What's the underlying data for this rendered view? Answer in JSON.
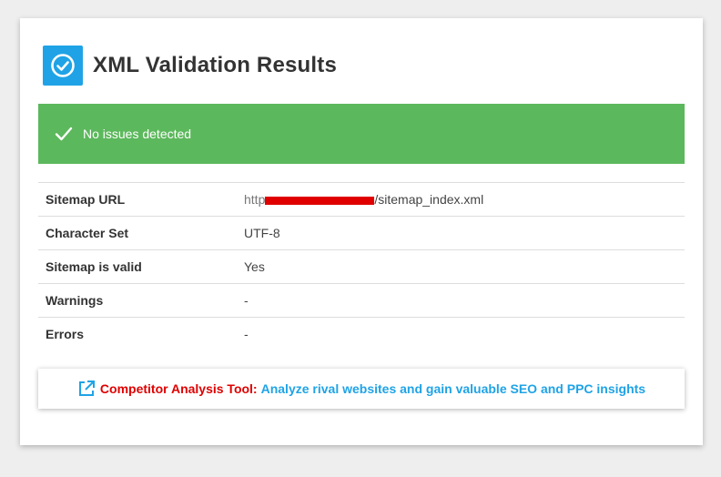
{
  "header": {
    "title": "XML Validation Results",
    "icon": "check-circle-icon",
    "icon_color": "#1fa3e6"
  },
  "banner": {
    "message": "No issues detected",
    "icon": "checkmark-icon",
    "color": "#5cb85c"
  },
  "results": [
    {
      "label": "Sitemap URL",
      "value": "/sitemap_index.xml",
      "redacted_prefix": "http"
    },
    {
      "label": "Character Set",
      "value": "UTF-8"
    },
    {
      "label": "Sitemap is valid",
      "value": "Yes"
    },
    {
      "label": "Warnings",
      "value": "-"
    },
    {
      "label": "Errors",
      "value": "-"
    }
  ],
  "promo": {
    "icon": "external-link-icon",
    "label": "Competitor Analysis Tool:",
    "link_text": "Analyze rival websites and gain valuable SEO and PPC insights",
    "label_color": "#e00000",
    "link_color": "#1fa3e6"
  }
}
